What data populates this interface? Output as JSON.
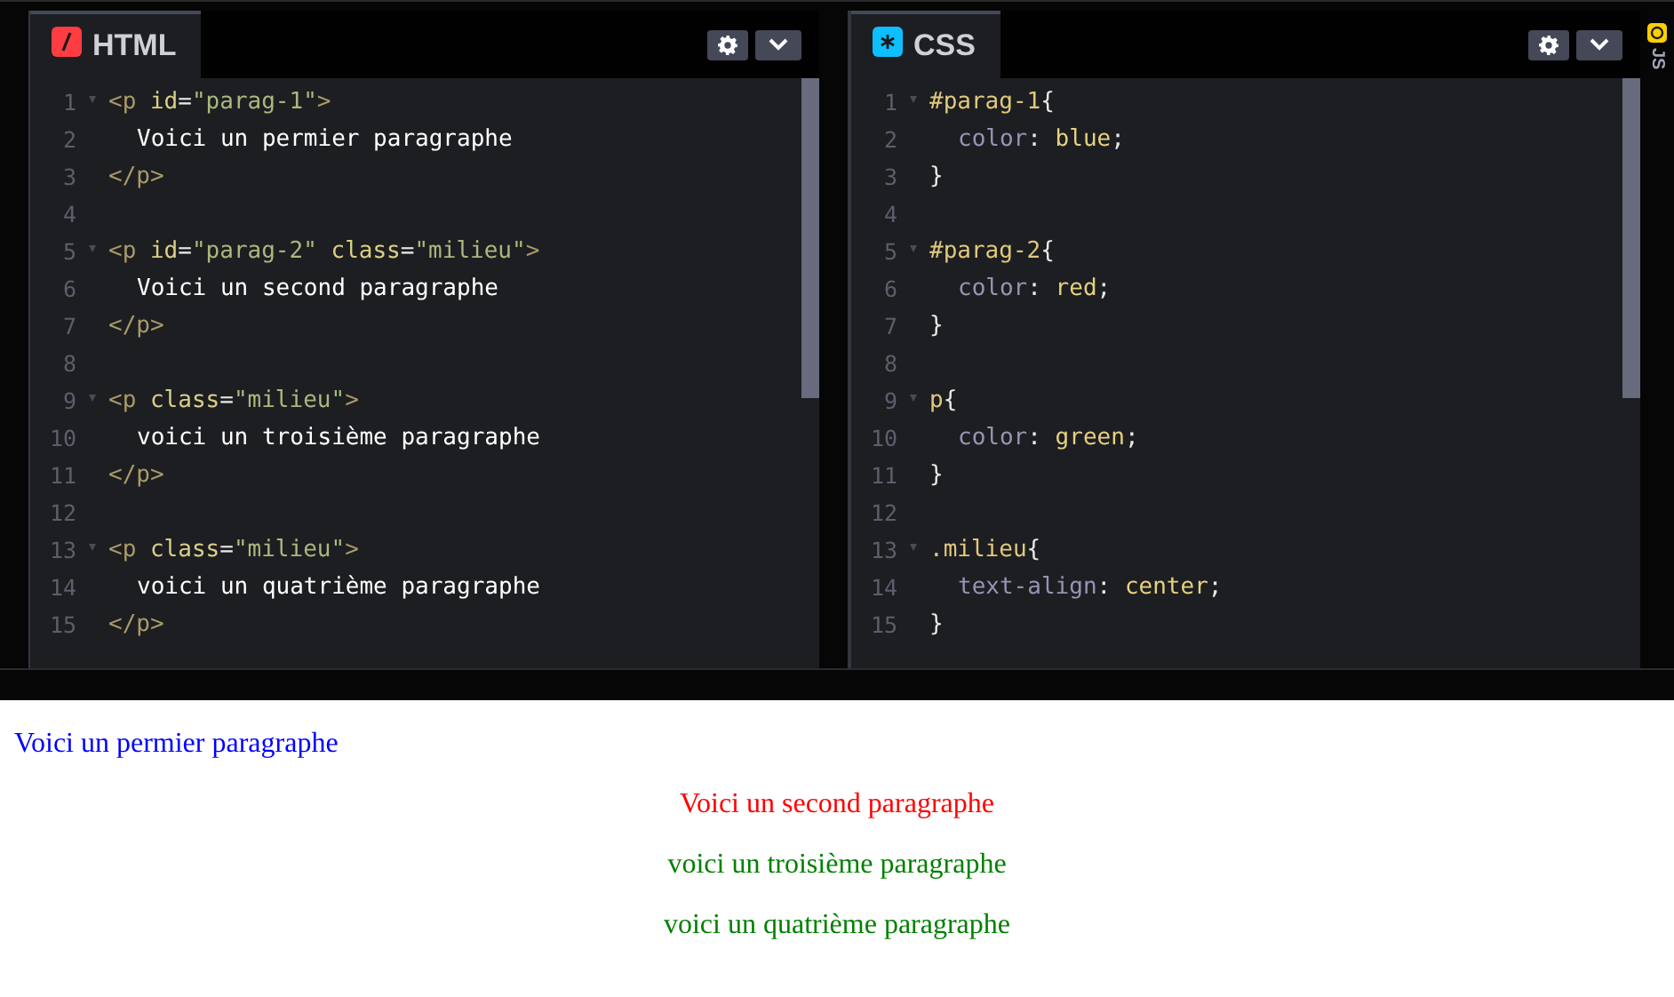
{
  "editors": [
    {
      "kind": "html",
      "title": "HTML",
      "lines": [
        {
          "number": "1",
          "foldable": true,
          "tokens": [
            {
              "kind": "tag",
              "text": "<p"
            },
            {
              "kind": "attr",
              "text": " id"
            },
            {
              "kind": "punct",
              "text": "="
            },
            {
              "kind": "string",
              "text": "\"parag-1\""
            },
            {
              "kind": "tag",
              "text": ">"
            }
          ]
        },
        {
          "number": "2",
          "foldable": false,
          "indent": true,
          "tokens": [
            {
              "kind": "text",
              "text": "Voici un permier paragraphe"
            }
          ]
        },
        {
          "number": "3",
          "foldable": false,
          "tokens": [
            {
              "kind": "tag",
              "text": "</p>"
            }
          ]
        },
        {
          "number": "4",
          "foldable": false
        },
        {
          "number": "5",
          "foldable": true,
          "tokens": [
            {
              "kind": "tag",
              "text": "<p"
            },
            {
              "kind": "attr",
              "text": " id"
            },
            {
              "kind": "punct",
              "text": "="
            },
            {
              "kind": "string",
              "text": "\"parag-2\""
            },
            {
              "kind": "attr",
              "text": " class"
            },
            {
              "kind": "punct",
              "text": "="
            },
            {
              "kind": "string",
              "text": "\"milieu\""
            },
            {
              "kind": "tag",
              "text": ">"
            }
          ]
        },
        {
          "number": "6",
          "foldable": false,
          "indent": true,
          "tokens": [
            {
              "kind": "text",
              "text": "Voici un second paragraphe"
            }
          ]
        },
        {
          "number": "7",
          "foldable": false,
          "tokens": [
            {
              "kind": "tag",
              "text": "</p>"
            }
          ]
        },
        {
          "number": "8",
          "foldable": false
        },
        {
          "number": "9",
          "foldable": true,
          "tokens": [
            {
              "kind": "tag",
              "text": "<p"
            },
            {
              "kind": "attr",
              "text": " class"
            },
            {
              "kind": "punct",
              "text": "="
            },
            {
              "kind": "string",
              "text": "\"milieu\""
            },
            {
              "kind": "tag",
              "text": ">"
            }
          ]
        },
        {
          "number": "10",
          "foldable": false,
          "indent": true,
          "tokens": [
            {
              "kind": "text",
              "text": "voici un troisième paragraphe"
            }
          ]
        },
        {
          "number": "11",
          "foldable": false,
          "tokens": [
            {
              "kind": "tag",
              "text": "</p>"
            }
          ]
        },
        {
          "number": "12",
          "foldable": false
        },
        {
          "number": "13",
          "foldable": true,
          "tokens": [
            {
              "kind": "tag",
              "text": "<p"
            },
            {
              "kind": "attr",
              "text": " class"
            },
            {
              "kind": "punct",
              "text": "="
            },
            {
              "kind": "string",
              "text": "\"milieu\""
            },
            {
              "kind": "tag",
              "text": ">"
            }
          ]
        },
        {
          "number": "14",
          "foldable": false,
          "indent": true,
          "tokens": [
            {
              "kind": "text",
              "text": "voici un quatrième paragraphe"
            }
          ]
        },
        {
          "number": "15",
          "foldable": false,
          "tokens": [
            {
              "kind": "tag",
              "text": "</p>"
            }
          ]
        }
      ]
    },
    {
      "kind": "css",
      "title": "CSS",
      "lines": [
        {
          "number": "1",
          "foldable": true,
          "tokens": [
            {
              "kind": "selector",
              "text": "#parag-1"
            },
            {
              "kind": "punct",
              "text": "{"
            }
          ]
        },
        {
          "number": "2",
          "foldable": false,
          "indent": true,
          "tokens": [
            {
              "kind": "property",
              "text": "color"
            },
            {
              "kind": "punct",
              "text": ": "
            },
            {
              "kind": "value",
              "text": "blue"
            },
            {
              "kind": "punct",
              "text": ";"
            }
          ]
        },
        {
          "number": "3",
          "foldable": false,
          "tokens": [
            {
              "kind": "punct",
              "text": "}"
            }
          ]
        },
        {
          "number": "4",
          "foldable": false
        },
        {
          "number": "5",
          "foldable": true,
          "tokens": [
            {
              "kind": "selector",
              "text": "#parag-2"
            },
            {
              "kind": "punct",
              "text": "{"
            }
          ]
        },
        {
          "number": "6",
          "foldable": false,
          "indent": true,
          "tokens": [
            {
              "kind": "property",
              "text": "color"
            },
            {
              "kind": "punct",
              "text": ": "
            },
            {
              "kind": "value",
              "text": "red"
            },
            {
              "kind": "punct",
              "text": ";"
            }
          ]
        },
        {
          "number": "7",
          "foldable": false,
          "tokens": [
            {
              "kind": "punct",
              "text": "}"
            }
          ]
        },
        {
          "number": "8",
          "foldable": false
        },
        {
          "number": "9",
          "foldable": true,
          "tokens": [
            {
              "kind": "selector",
              "text": "p"
            },
            {
              "kind": "punct",
              "text": "{"
            }
          ]
        },
        {
          "number": "10",
          "foldable": false,
          "indent": true,
          "tokens": [
            {
              "kind": "property",
              "text": "color"
            },
            {
              "kind": "punct",
              "text": ": "
            },
            {
              "kind": "value",
              "text": "green"
            },
            {
              "kind": "punct",
              "text": ";"
            }
          ]
        },
        {
          "number": "11",
          "foldable": false,
          "tokens": [
            {
              "kind": "punct",
              "text": "}"
            }
          ]
        },
        {
          "number": "12",
          "foldable": false
        },
        {
          "number": "13",
          "foldable": true,
          "tokens": [
            {
              "kind": "selector",
              "text": ".milieu"
            },
            {
              "kind": "punct",
              "text": "{"
            }
          ]
        },
        {
          "number": "14",
          "foldable": false,
          "indent": true,
          "tokens": [
            {
              "kind": "property",
              "text": "text-align"
            },
            {
              "kind": "punct",
              "text": ": "
            },
            {
              "kind": "value",
              "text": "center"
            },
            {
              "kind": "punct",
              "text": ";"
            }
          ]
        },
        {
          "number": "15",
          "foldable": false,
          "tokens": [
            {
              "kind": "punct",
              "text": "}"
            }
          ]
        }
      ]
    }
  ],
  "side_tab": {
    "label": "JS"
  },
  "preview": {
    "paragraphs": [
      {
        "text": "Voici un permier paragraphe",
        "color": "#0000ff",
        "centered": false
      },
      {
        "text": "Voici un second paragraphe",
        "color": "#ff0000",
        "centered": true
      },
      {
        "text": "voici un troisième paragraphe",
        "color": "#008000",
        "centered": true
      },
      {
        "text": "voici un quatrième paragraphe",
        "color": "#008000",
        "centered": true
      }
    ]
  }
}
